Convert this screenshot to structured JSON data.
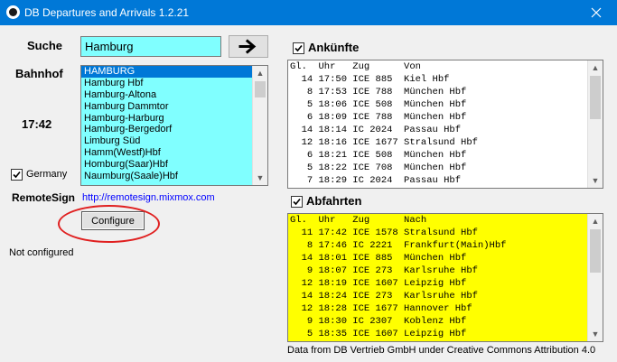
{
  "window": {
    "title": "DB Departures and Arrivals 1.2.21"
  },
  "search": {
    "label": "Suche",
    "value": "Hamburg"
  },
  "station": {
    "label": "Bahnhof",
    "items": [
      "HAMBURG",
      "Hamburg Hbf",
      "Hamburg-Altona",
      "Hamburg Dammtor",
      "Hamburg-Harburg",
      "Hamburg-Bergedorf",
      "Limburg Süd",
      "Hamm(Westf)Hbf",
      "Homburg(Saar)Hbf",
      "Naumburg(Saale)Hbf"
    ],
    "selected_index": 0
  },
  "clock": "17:42",
  "germany": {
    "label": "Germany",
    "checked": true
  },
  "remote": {
    "label": "RemoteSign",
    "url": "http://remotesign.mixmox.com"
  },
  "configure": {
    "label": "Configure"
  },
  "status": "Not configured",
  "arrivals": {
    "title": "Ankünfte",
    "checked": true,
    "header": {
      "gl": "Gl.",
      "uhr": "Uhr",
      "zug": "Zug",
      "station": "Von"
    },
    "rows": [
      {
        "gl": "14",
        "uhr": "17:50",
        "zug": "ICE 885",
        "station": "Kiel Hbf"
      },
      {
        "gl": "8",
        "uhr": "17:53",
        "zug": "ICE 788",
        "station": "München Hbf"
      },
      {
        "gl": "5",
        "uhr": "18:06",
        "zug": "ICE 508",
        "station": "München Hbf"
      },
      {
        "gl": "6",
        "uhr": "18:09",
        "zug": "ICE 788",
        "station": "München Hbf"
      },
      {
        "gl": "14",
        "uhr": "18:14",
        "zug": "IC 2024",
        "station": "Passau Hbf"
      },
      {
        "gl": "12",
        "uhr": "18:16",
        "zug": "ICE 1677",
        "station": "Stralsund Hbf"
      },
      {
        "gl": "6",
        "uhr": "18:21",
        "zug": "ICE 508",
        "station": "München Hbf"
      },
      {
        "gl": "5",
        "uhr": "18:22",
        "zug": "ICE 708",
        "station": "München Hbf"
      },
      {
        "gl": "7",
        "uhr": "18:29",
        "zug": "IC 2024",
        "station": "Passau Hbf"
      }
    ]
  },
  "departures": {
    "title": "Abfahrten",
    "checked": true,
    "header": {
      "gl": "Gl.",
      "uhr": "Uhr",
      "zug": "Zug",
      "station": "Nach"
    },
    "rows": [
      {
        "gl": "11",
        "uhr": "17:42",
        "zug": "ICE 1578",
        "station": "Stralsund Hbf"
      },
      {
        "gl": "8",
        "uhr": "17:46",
        "zug": "IC 2221",
        "station": "Frankfurt(Main)Hbf"
      },
      {
        "gl": "14",
        "uhr": "18:01",
        "zug": "ICE 885",
        "station": "München Hbf"
      },
      {
        "gl": "9",
        "uhr": "18:07",
        "zug": "ICE 273",
        "station": "Karlsruhe Hbf"
      },
      {
        "gl": "12",
        "uhr": "18:19",
        "zug": "ICE 1607",
        "station": "Leipzig Hbf"
      },
      {
        "gl": "14",
        "uhr": "18:24",
        "zug": "ICE 273",
        "station": "Karlsruhe Hbf"
      },
      {
        "gl": "12",
        "uhr": "18:28",
        "zug": "ICE 1677",
        "station": "Hannover Hbf"
      },
      {
        "gl": "9",
        "uhr": "18:30",
        "zug": "IC 2307",
        "station": "Koblenz Hbf"
      },
      {
        "gl": "5",
        "uhr": "18:35",
        "zug": "ICE 1607",
        "station": "Leipzig Hbf"
      }
    ]
  },
  "footer": "Data from DB Vertrieb GmbH under Creative Commons Attribution 4.0",
  "colors": {
    "titlebar": "#0078d7",
    "cyan_field": "#80ffff",
    "departures_bg": "#ffff00",
    "link": "#0000ff",
    "highlight": "#e02020"
  },
  "icons": {
    "app": "app-icon",
    "close": "close-icon",
    "go": "arrow-right-icon",
    "check": "checkmark-icon"
  }
}
